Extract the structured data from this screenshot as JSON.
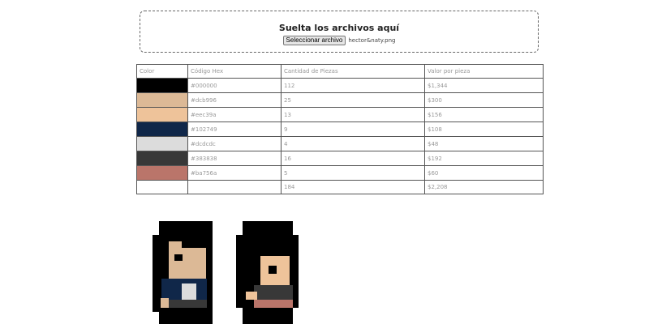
{
  "upload": {
    "title": "Suelta los archivos aquí",
    "button_label": "Seleccionar archivo",
    "file_name": "hector&naty.png"
  },
  "table": {
    "headers": [
      "Color",
      "Código Hex",
      "Cantidad de Piezas",
      "Valor por pieza"
    ],
    "rows": [
      {
        "color": "#000000",
        "hex": "#000000",
        "qty": "112",
        "value": "$1,344"
      },
      {
        "color": "#dcb996",
        "hex": "#dcb996",
        "qty": "25",
        "value": "$300"
      },
      {
        "color": "#eec39a",
        "hex": "#eec39a",
        "qty": "13",
        "value": "$156"
      },
      {
        "color": "#102749",
        "hex": "#102749",
        "qty": "9",
        "value": "$108"
      },
      {
        "color": "#dcdcdc",
        "hex": "#dcdcdc",
        "qty": "4",
        "value": "$48"
      },
      {
        "color": "#383838",
        "hex": "#383838",
        "qty": "16",
        "value": "$192"
      },
      {
        "color": "#ba756a",
        "hex": "#ba756a",
        "qty": "5",
        "value": "$60"
      }
    ],
    "totals": {
      "qty": "184",
      "value": "$2,208"
    }
  }
}
